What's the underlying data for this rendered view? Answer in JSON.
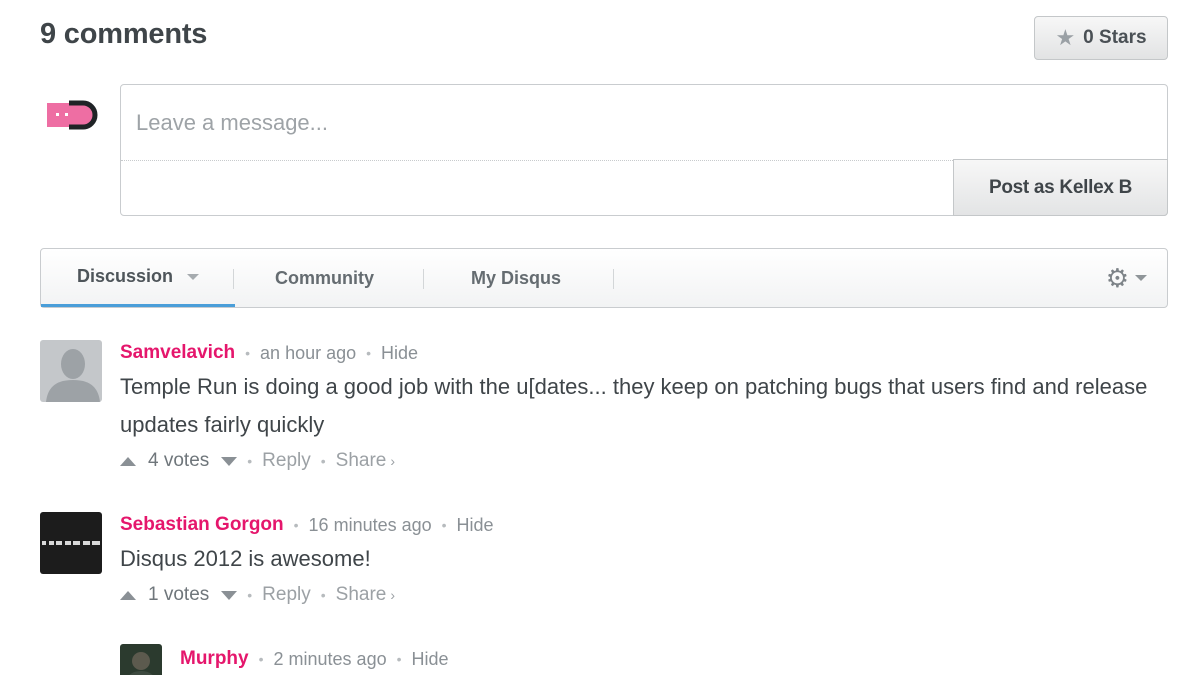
{
  "header": {
    "comment_count": "9 comments",
    "stars_label": "0 Stars",
    "star_icon": "star-icon"
  },
  "logo": {
    "icon": "disqus-logo-icon",
    "colors": [
      "#ee6ea3",
      "#1f2326"
    ]
  },
  "compose": {
    "placeholder": "Leave a message...",
    "value": "",
    "post_button_label": "Post as Kellex B"
  },
  "tabs": {
    "items": [
      {
        "label": "Discussion",
        "active": true
      },
      {
        "label": "Community",
        "active": false
      },
      {
        "label": "My Disqus",
        "active": false
      }
    ],
    "settings_icon": "gear-icon"
  },
  "comments": [
    {
      "author": "Samvelavich",
      "time": "an hour ago",
      "hide_label": "Hide",
      "body": "Temple Run is doing a good job with the u[dates... they keep on patching bugs that users find and release updates fairly quickly",
      "votes": "4 votes",
      "reply_label": "Reply",
      "share_label": "Share",
      "avatar": "default-silhouette-avatar"
    },
    {
      "author": "Sebastian Gorgon",
      "time": "16 minutes ago",
      "hide_label": "Hide",
      "body": "Disqus 2012 is awesome!",
      "votes": "1 votes",
      "reply_label": "Reply",
      "share_label": "Share",
      "avatar": "black-logo-avatar"
    },
    {
      "author": "Murphy",
      "time": "2 minutes ago",
      "hide_label": "Hide",
      "avatar": "photo-avatar"
    }
  ],
  "colors": {
    "author": "#e5166c",
    "active_tab_underline": "#4a9ed9",
    "text": "#3f4549",
    "muted": "#8a9095"
  }
}
